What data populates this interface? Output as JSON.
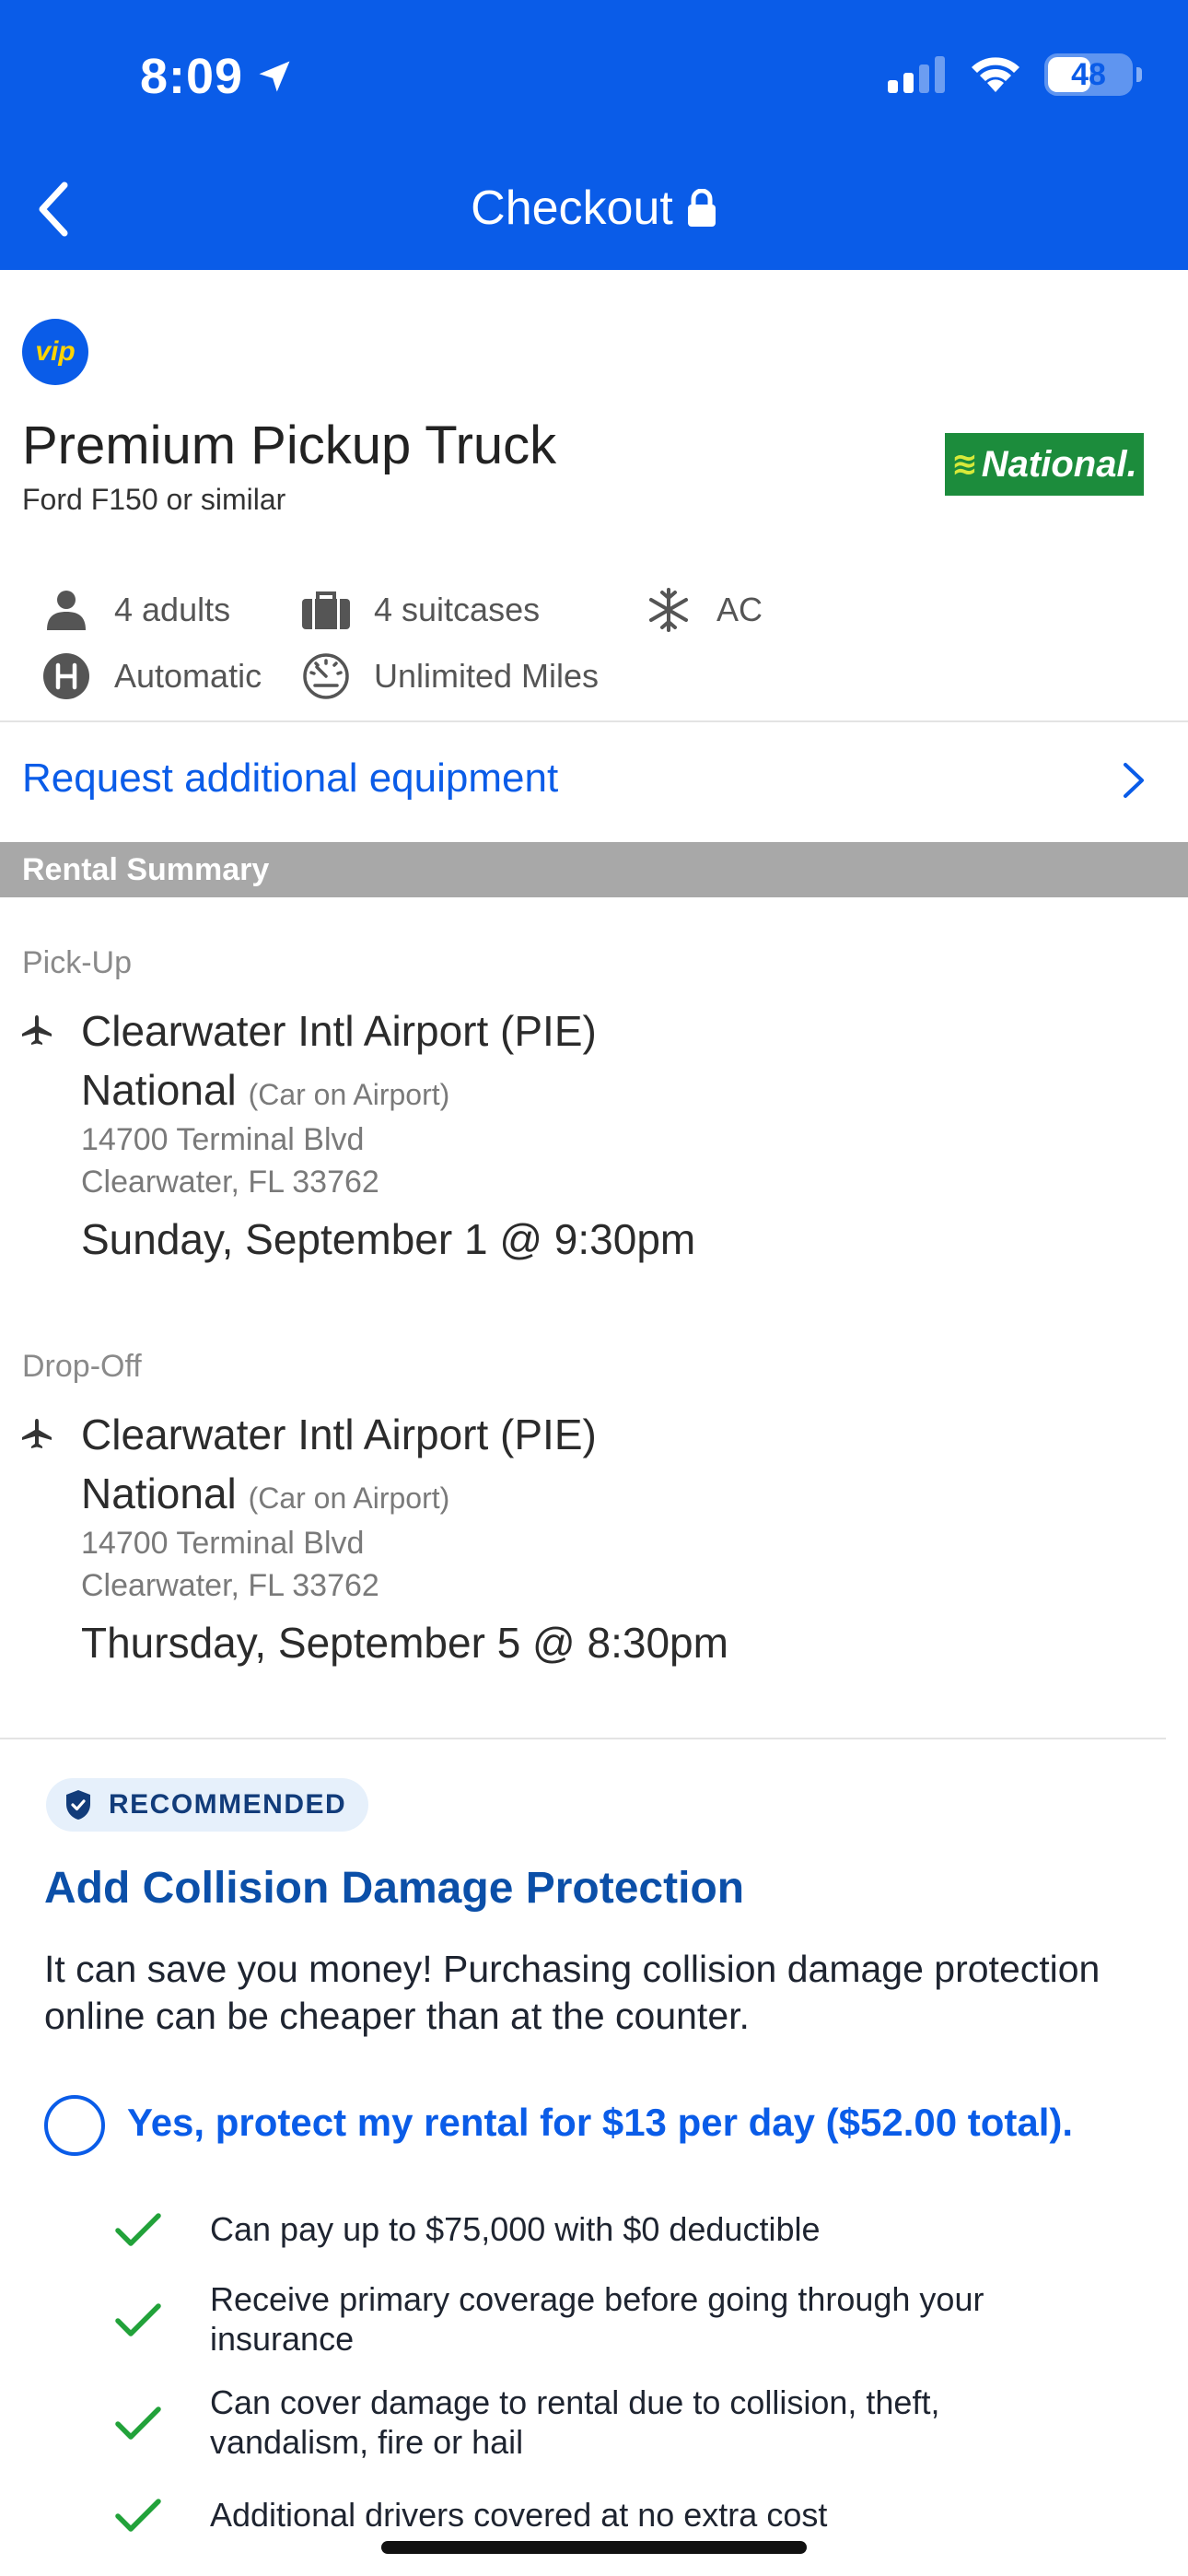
{
  "status_bar": {
    "time": "8:09",
    "battery": "48"
  },
  "header": {
    "title": "Checkout"
  },
  "vehicle": {
    "badge": "vip",
    "title": "Premium Pickup Truck",
    "subtitle": "Ford F150 or similar",
    "vendor_logo_text": "National.",
    "features": [
      {
        "icon": "person-icon",
        "label": "4 adults"
      },
      {
        "icon": "suitcase-icon",
        "label": "4 suitcases"
      },
      {
        "icon": "snowflake-icon",
        "label": "AC"
      },
      {
        "icon": "gearshift-icon",
        "label": "Automatic"
      },
      {
        "icon": "speedometer-icon",
        "label": "Unlimited Miles"
      }
    ]
  },
  "equipment_link": "Request additional equipment",
  "rental_summary": {
    "section_title": "Rental Summary",
    "pickup": {
      "label": "Pick-Up",
      "airport": "Clearwater Intl Airport (PIE)",
      "vendor": "National",
      "vendor_note": "(Car on Airport)",
      "address_line1": "14700 Terminal Blvd",
      "address_line2": "Clearwater, FL 33762",
      "datetime": "Sunday, September 1 @ 9:30pm"
    },
    "dropoff": {
      "label": "Drop-Off",
      "airport": "Clearwater Intl Airport (PIE)",
      "vendor": "National",
      "vendor_note": "(Car on Airport)",
      "address_line1": "14700 Terminal Blvd",
      "address_line2": "Clearwater, FL 33762",
      "datetime": "Thursday, September 5 @ 8:30pm"
    }
  },
  "protection": {
    "badge": "RECOMMENDED",
    "title": "Add Collision Damage Protection",
    "description": "It can save you money! Purchasing collision damage protection online can be cheaper than at the counter.",
    "option_label": "Yes, protect my rental for $13 per day ($52.00 total).",
    "benefits": [
      "Can pay up to $75,000 with $0 deductible",
      "Receive primary coverage before going through your insurance",
      "Can cover damage to rental due to collision, theft, vandalism, fire or hail",
      "Additional drivers covered at no extra cost"
    ]
  },
  "colors": {
    "brand_blue": "#0a5ce8",
    "national_green": "#1c8c3c",
    "check_green": "#22a23a",
    "section_gray": "#a8a8a8"
  }
}
